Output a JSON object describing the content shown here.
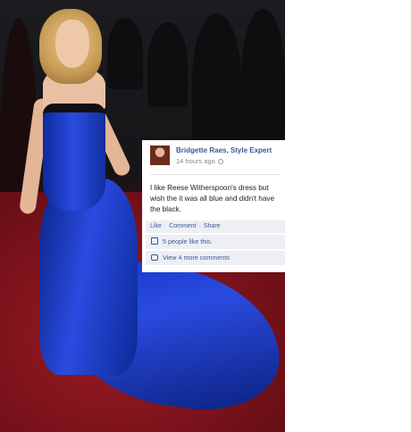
{
  "colors": {
    "fb_link": "#3b5998",
    "fb_panel_bg": "#edeff4",
    "dress_blue": "#2a4be0",
    "carpet_red": "#8a1520"
  },
  "photo": {
    "subject": "woman in blue strapless gown on red carpet"
  },
  "comment": {
    "author": "Bridgette Raes, Style Expert",
    "time": "14 hours ago",
    "privacy_icon": "globe-icon",
    "body": "I like Reese Witherspoon's dress but wish the it was all blue and didn't have the black.",
    "actions": {
      "like": "Like",
      "comment": "Comment",
      "share": "Share",
      "separator": "·"
    },
    "likes_text": "5 people like this.",
    "likes_icon": "thumbs-up-icon",
    "more_comments": "View 4 more comments",
    "more_icon": "comment-bubble-icon"
  }
}
